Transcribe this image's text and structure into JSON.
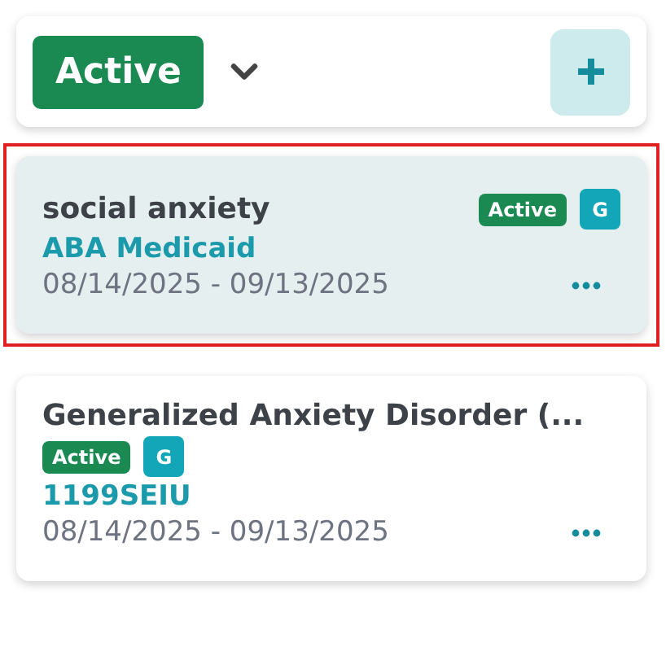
{
  "filter": {
    "label": "Active"
  },
  "cards": [
    {
      "kind": "badges-right",
      "selected": true,
      "title": "social anxiety",
      "status": "Active",
      "tag": "G",
      "payer": "ABA Medicaid",
      "dates": "08/14/2025 - 09/13/2025"
    },
    {
      "kind": "badges-below",
      "selected": false,
      "title": "Generalized Anxiety Disorder (...",
      "status": "Active",
      "tag": "G",
      "payer": "1199SEIU",
      "dates": "08/14/2025 - 09/13/2025"
    }
  ]
}
